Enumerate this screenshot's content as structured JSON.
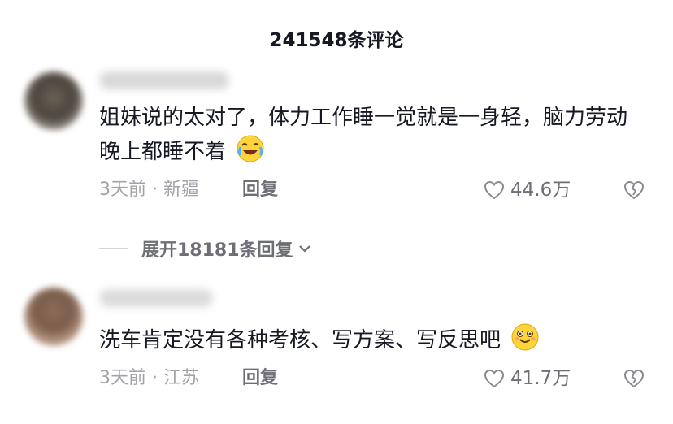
{
  "header": {
    "title": "241548条评论"
  },
  "comments": [
    {
      "text": "姐妹说的太对了，体力工作睡一觉就是一身轻，脑力劳动晚上都睡不着",
      "emoji": "crying-laughing-emoji",
      "time_location": "3天前 · 新疆",
      "reply_label": "回复",
      "like_count": "44.6万"
    },
    {
      "text": "洗车肯定没有各种考核、写方案、写反思吧",
      "emoji": "grinning-emoji",
      "time_location": "3天前 · 江苏",
      "reply_label": "回复",
      "like_count": "41.7万"
    }
  ],
  "expand_replies": {
    "label": "展开18181条回复"
  },
  "icons": {
    "like": "heart-outline-icon",
    "dislike": "broken-heart-icon",
    "expand": "chevron-down-icon"
  },
  "colors": {
    "primary_text": "#161823",
    "secondary_text": "#a2a3a8",
    "action_text": "#6e6f76"
  }
}
